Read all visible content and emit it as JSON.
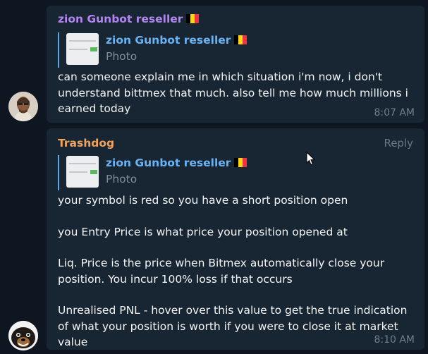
{
  "messages": [
    {
      "sender": "zion Gunbot reseller",
      "reply": {
        "name": "zion Gunbot reseller",
        "type": "Photo"
      },
      "paragraphs": [
        "can someone explain me in which situation i'm now, i don't understand bittmex that much. also tell me how much millions i earned today"
      ],
      "time": "8:07 AM"
    },
    {
      "sender": "Trashdog",
      "reply_button": "Reply",
      "reply": {
        "name": "zion Gunbot reseller",
        "type": "Photo"
      },
      "paragraphs": [
        "your symbol is red so you have a short position open",
        "you Entry Price is what price your position opened at",
        "Liq. Price is the price when Bitmex automatically close your position. You incur 100% loss if that occurs",
        "Unrealised PNL - hover over this value to get the true indication of what your position is worth if you were to close it at market value"
      ],
      "time": "8:10 AM"
    }
  ],
  "colors": {
    "background": "#0e1621",
    "bubble": "#182533",
    "sender1": "#b286f0",
    "sender2": "#f0a35e",
    "reply_accent": "#6ab3f3"
  }
}
